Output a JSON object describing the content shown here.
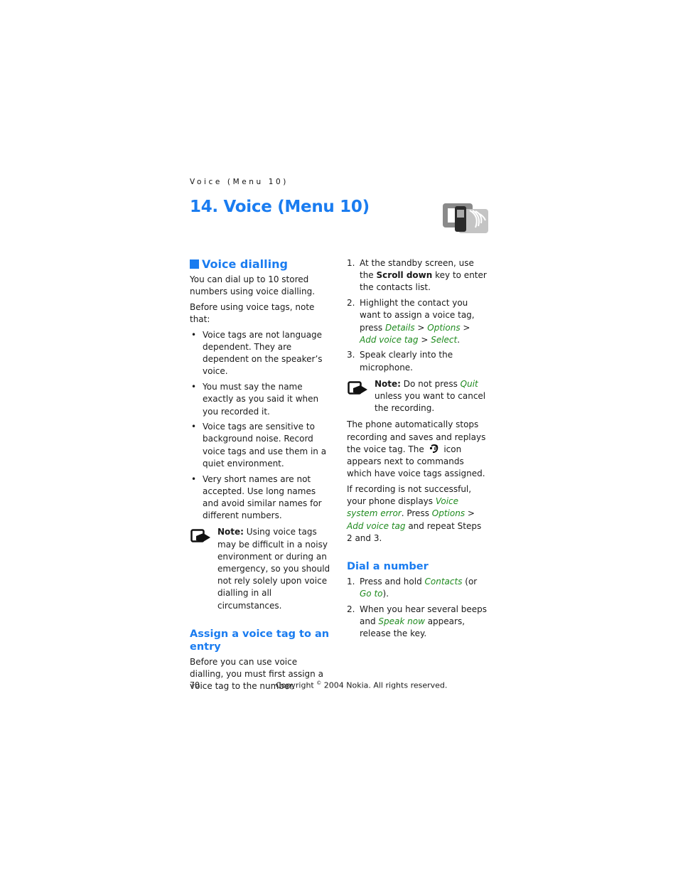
{
  "running_head": "Voice (Menu 10)",
  "chapter": {
    "title": "14. Voice (Menu 10)",
    "icon": "phone-voice-icon"
  },
  "left_column": {
    "section_title": "Voice dialling",
    "intro": "You can dial up to 10 stored numbers using voice dialling.",
    "before_note": "Before using voice tags, note that:",
    "bullets": [
      "Voice tags are not language dependent. They are dependent on the speaker’s voice.",
      "You must say the name exactly as you said it when you recorded it.",
      "Voice tags are sensitive to background noise. Record voice tags and use them in a quiet environment.",
      "Very short names are not accepted. Use long names and avoid similar names for different numbers."
    ],
    "note": {
      "label": "Note:",
      "text": " Using voice tags may be difficult in a noisy environment or during an emergency, so you should not rely solely upon voice dialling in all circumstances."
    },
    "subsection_title": "Assign a voice tag to an entry",
    "subsection_text": "Before you can use voice dialling, you must first assign a voice tag to the number."
  },
  "right_column": {
    "steps": [
      {
        "num": "1.",
        "pre": "At the standby screen, use the ",
        "bold": "Scroll down",
        "post": " key to enter the contacts list."
      },
      {
        "num": "2.",
        "pre": "Highlight the contact you want to assign a voice tag, press ",
        "menu1": "Details",
        "sep1": " > ",
        "menu2": "Options",
        "sep2": " > ",
        "menu3": "Add voice tag",
        "sep3": " > ",
        "menu4": "Select",
        "post": "."
      },
      {
        "num": "3.",
        "text": "Speak clearly into the microphone."
      }
    ],
    "note": {
      "label": "Note:",
      "pre": " Do not press ",
      "menu": "Quit",
      "post": " unless you want to cancel the recording."
    },
    "para1": {
      "pre": "The phone automatically stops recording and saves and replays the voice tag. The ",
      "icon": "voice-tag-icon",
      "post": " icon appears next to commands which have voice tags assigned."
    },
    "para2": {
      "pre": "If recording is not successful, your phone displays ",
      "menu1": "Voice system error",
      "mid1": ". Press ",
      "menu2": "Options",
      "sep": " > ",
      "menu3": "Add voice tag",
      "post": " and repeat Steps 2 and 3."
    },
    "dial_title": "Dial a number",
    "dial_steps": [
      {
        "num": "1.",
        "pre": "Press and hold ",
        "menu1": "Contacts",
        "mid": " (or ",
        "menu2": "Go to",
        "post": ")."
      },
      {
        "num": "2.",
        "pre": "When you hear several beeps and ",
        "menu1": "Speak now",
        "post": " appears, release the key."
      }
    ]
  },
  "footer": {
    "page_number": "70",
    "copyright_pre": "Copyright ",
    "copyright_symbol": "©",
    "copyright_post": " 2004 Nokia. All rights reserved."
  },
  "colors": {
    "heading_blue": "#1a7cf0",
    "menu_green": "#1e8a1e"
  }
}
